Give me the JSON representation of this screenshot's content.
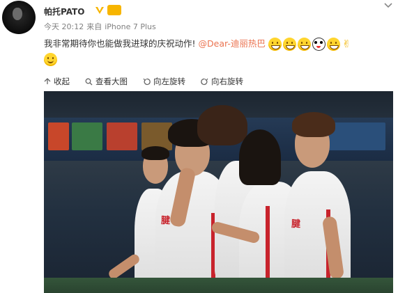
{
  "post": {
    "username": "帕托PATO",
    "verified_icon": "verified-v-badge",
    "vip_icon": "vip-badge",
    "vip_label": "",
    "meta": {
      "time": "今天 20:12",
      "from_label": "来自",
      "device": "iPhone 7 Plus"
    },
    "content": {
      "text": "我非常期待你也能做我进球的庆祝动作!",
      "mention": "@Dear-迪丽热巴",
      "emoji": [
        "grin-emoji",
        "grin-emoji",
        "grin-emoji",
        "panda-emoji",
        "grin-emoji",
        "victory-hand-emoji",
        "smile-emoji"
      ]
    },
    "toolbar": {
      "collapse_label": "收起",
      "view_large_label": "查看大图",
      "rotate_left_label": "向左旋转",
      "rotate_right_label": "向右旋转"
    },
    "photo": {
      "shirt_text": "腱",
      "description_icon": "football-players-photo"
    }
  },
  "colors": {
    "mention": "#eb7350",
    "meta_text": "#808080",
    "verified": "#f7b500",
    "jersey_stripe": "#c8232c"
  }
}
